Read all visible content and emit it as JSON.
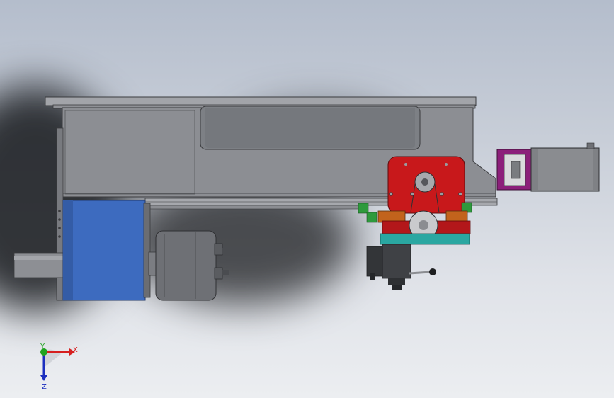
{
  "triad": {
    "x_label": "X",
    "y_label": "Y",
    "z_label": "Z",
    "x_color": "#d62020",
    "y_color": "#1fa31f",
    "z_color": "#1c2fbf"
  },
  "colors": {
    "frame": "#8c8e93",
    "frame_dark": "#5f6166",
    "plate_top": "#9a9ca1",
    "gearbox_blue": "#3d6bbf",
    "carriage_red": "#c8181b",
    "carriage_orange": "#c2631c",
    "base_teal": "#2aa7a1",
    "motor_gray": "#7f8185",
    "flange_purple": "#8c1f7a",
    "chuck_gray": "#6e7075"
  }
}
